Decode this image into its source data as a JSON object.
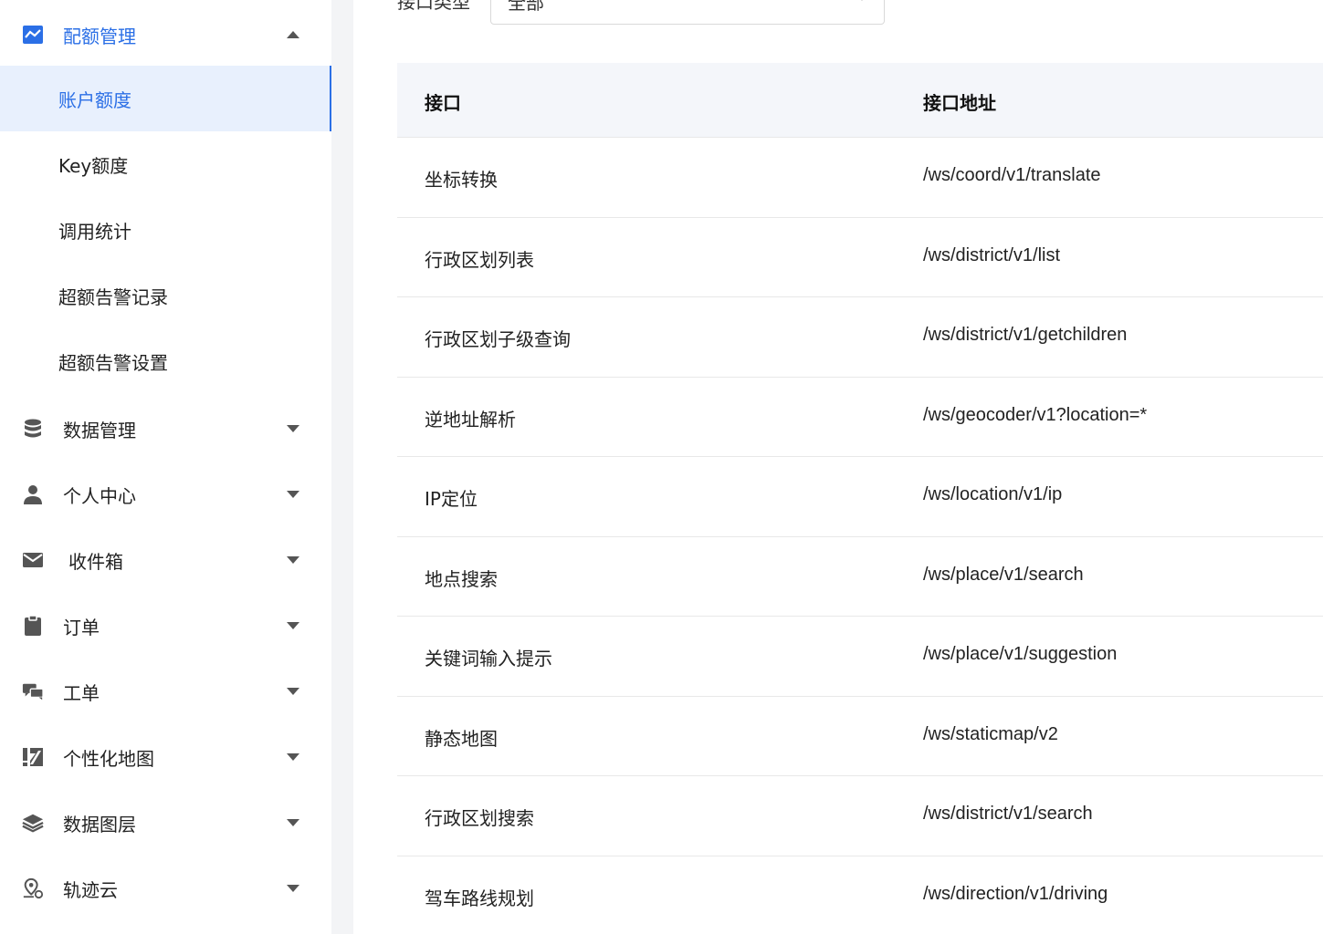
{
  "sidebar": {
    "quota": {
      "label": "配额管理",
      "icon": "chart-line-icon",
      "expanded": true,
      "children": [
        {
          "label": "账户额度",
          "active": true
        },
        {
          "label": "Key额度"
        },
        {
          "label": "调用统计"
        },
        {
          "label": "超额告警记录"
        },
        {
          "label": "超额告警设置"
        }
      ]
    },
    "menus": [
      {
        "label": "数据管理",
        "icon": "database-icon"
      },
      {
        "label": "个人中心",
        "icon": "user-icon"
      },
      {
        "label": "收件箱",
        "icon": "mail-icon"
      },
      {
        "label": "订单",
        "icon": "clipboard-icon"
      },
      {
        "label": "工单",
        "icon": "chat-icon"
      },
      {
        "label": "个性化地图",
        "icon": "map-style-icon"
      },
      {
        "label": "数据图层",
        "icon": "layers-icon"
      },
      {
        "label": "轨迹云",
        "icon": "location-track-icon"
      }
    ],
    "accent_color": "#2b6fe6"
  },
  "filter": {
    "label": "接口类型",
    "value": "全部"
  },
  "table": {
    "headers": [
      "接口",
      "接口地址"
    ],
    "rows": [
      [
        "坐标转换",
        "/ws/coord/v1/translate"
      ],
      [
        "行政区划列表",
        "/ws/district/v1/list"
      ],
      [
        "行政区划子级查询",
        "/ws/district/v1/getchildren"
      ],
      [
        "逆地址解析",
        "/ws/geocoder/v1?location=*"
      ],
      [
        "IP定位",
        "/ws/location/v1/ip"
      ],
      [
        "地点搜索",
        "/ws/place/v1/search"
      ],
      [
        "关键词输入提示",
        "/ws/place/v1/suggestion"
      ],
      [
        "静态地图",
        "/ws/staticmap/v2"
      ],
      [
        "行政区划搜索",
        "/ws/district/v1/search"
      ],
      [
        "驾车路线规划",
        "/ws/direction/v1/driving"
      ]
    ]
  }
}
